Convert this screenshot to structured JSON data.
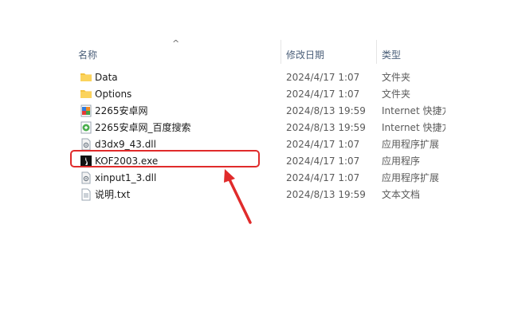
{
  "header": {
    "name": "名称",
    "date": "修改日期",
    "type": "类型"
  },
  "files": [
    {
      "name": "Data",
      "date": "2024/4/17 1:07",
      "type": "文件夹",
      "icon": "folder-icon"
    },
    {
      "name": "Options",
      "date": "2024/4/17 1:07",
      "type": "文件夹",
      "icon": "folder-icon"
    },
    {
      "name": "2265安卓网",
      "date": "2024/8/13 19:59",
      "type": "Internet 快捷方式",
      "icon": "internet-shortcut-icon"
    },
    {
      "name": "2265安卓网_百度搜索",
      "date": "2024/8/13 19:59",
      "type": "Internet 快捷方式",
      "icon": "internet-shortcut-icon"
    },
    {
      "name": "d3dx9_43.dll",
      "date": "2024/4/17 1:07",
      "type": "应用程序扩展",
      "icon": "dll-icon"
    },
    {
      "name": "KOF2003.exe",
      "date": "2024/4/17 1:07",
      "type": "应用程序",
      "icon": "exe-icon"
    },
    {
      "name": "xinput1_3.dll",
      "date": "2024/4/17 1:07",
      "type": "应用程序扩展",
      "icon": "dll-icon"
    },
    {
      "name": "说明.txt",
      "date": "2024/8/13 19:59",
      "type": "文本文档",
      "icon": "text-file-icon"
    }
  ],
  "colors": {
    "highlight": "#e02b2b",
    "folder": "#f4c33f"
  }
}
